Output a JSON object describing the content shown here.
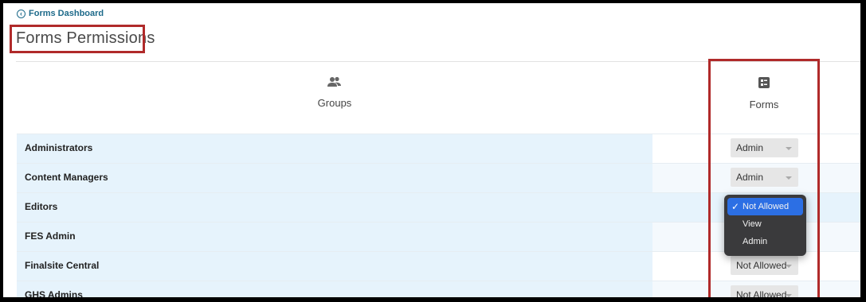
{
  "back_link": {
    "label": "Forms Dashboard",
    "icon": "arrow-left-circle-icon"
  },
  "page": {
    "title": "Forms Permissions"
  },
  "columns": {
    "groups": {
      "label": "Groups",
      "icon": "users-icon"
    },
    "forms": {
      "label": "Forms",
      "icon": "form-icon"
    }
  },
  "rows": [
    {
      "group": "Administrators",
      "forms_permission": "Admin"
    },
    {
      "group": "Content Managers",
      "forms_permission": "Admin"
    },
    {
      "group": "Editors",
      "forms_permission": "Not Allowed"
    },
    {
      "group": "FES Admin",
      "forms_permission": ""
    },
    {
      "group": "Finalsite Central",
      "forms_permission": "Not Allowed"
    },
    {
      "group": "GHS Admins",
      "forms_permission": "Not Allowed"
    }
  ],
  "dropdown": {
    "options": [
      "Not Allowed",
      "View",
      "Admin"
    ],
    "selected": "Not Allowed",
    "check": "✓"
  },
  "colors": {
    "highlight": "#b02a2a",
    "row_bg": "#e6f3fc",
    "link": "#1d6a8a",
    "menu_selected": "#2c6fe4"
  }
}
